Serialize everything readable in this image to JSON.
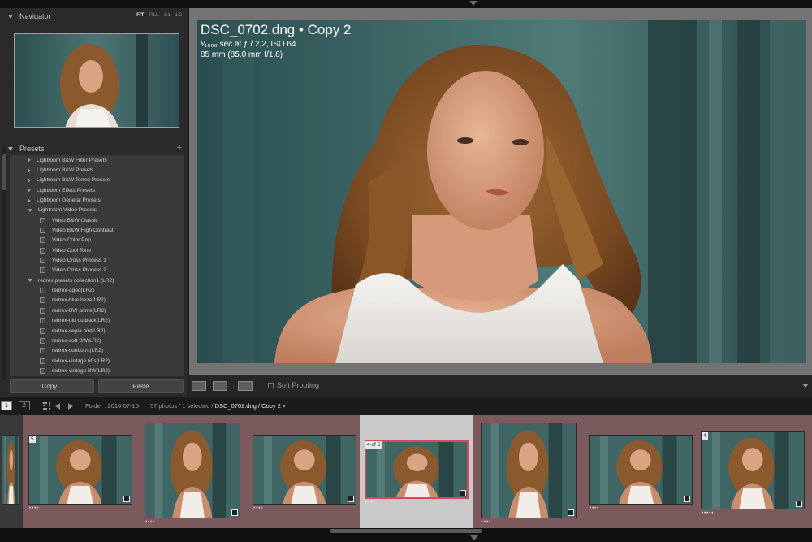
{
  "navigator": {
    "title": "Navigator",
    "modes": [
      "FIT",
      "FILL",
      "1:1",
      "1:2"
    ]
  },
  "presets": {
    "title": "Presets",
    "add_icon": "plus-icon",
    "rows": [
      {
        "kind": "folder",
        "open": false,
        "label": "Lightroom B&W Filter Presets"
      },
      {
        "kind": "folder",
        "open": false,
        "label": "Lightroom B&W Presets"
      },
      {
        "kind": "folder",
        "open": false,
        "label": "Lightroom B&W Toned Presets"
      },
      {
        "kind": "folder",
        "open": false,
        "label": "Lightroom Effect Presets"
      },
      {
        "kind": "folder",
        "open": false,
        "label": "Lightroom General Presets"
      },
      {
        "kind": "folder",
        "open": true,
        "label": "Lightroom Video Presets"
      },
      {
        "kind": "item",
        "label": "Video B&W Classic"
      },
      {
        "kind": "item",
        "label": "Video B&W High Contrast"
      },
      {
        "kind": "item",
        "label": "Video Color Pop"
      },
      {
        "kind": "item",
        "label": "Video Cool Tone"
      },
      {
        "kind": "item",
        "label": "Video Cross Process 1"
      },
      {
        "kind": "item",
        "label": "Video Cross Process 2"
      },
      {
        "kind": "folder",
        "open": true,
        "label": "redrex presets collection1 (LR2)"
      },
      {
        "kind": "item",
        "label": "redrex-aged(LR2)"
      },
      {
        "kind": "item",
        "label": "redrex-blue haze(LR2)"
      },
      {
        "kind": "item",
        "label": "redrex-BW prime(LR2)"
      },
      {
        "kind": "item",
        "label": "redrex-old outback(LR2)"
      },
      {
        "kind": "item",
        "label": "redrex-sepia hint(LR2)"
      },
      {
        "kind": "item",
        "label": "redrex-soft BW(LR2)"
      },
      {
        "kind": "item",
        "label": "redrex-sunburnt(LR2)"
      },
      {
        "kind": "item",
        "label": "redrex-vintage 60s(LR2)"
      },
      {
        "kind": "item",
        "label": "redrex-vintage BW(LR2)"
      }
    ]
  },
  "buttons": {
    "copy": "Copy...",
    "paste": "Paste"
  },
  "photo_info": {
    "filename": "DSC_0702.dng  •  Copy 2",
    "exposure": "¹⁄₁₀₀₀ sec at ƒ / 2,2, ISO 64",
    "lens": "85 mm (85.0 mm f/1.8)"
  },
  "toolbar": {
    "soft_proofing": "Soft Proofing"
  },
  "filmstrip_bar": {
    "screen1": "1",
    "screen2": "2",
    "folder": "Folder : 2016-07-15",
    "count": "57 photos / 1 selected / ",
    "current": "DSC_0702.dng / Copy 2",
    "dropdown": "▾"
  },
  "filmstrip": {
    "badges": {
      "first": "5",
      "selected": "4 of 5",
      "last": "4"
    },
    "stars": [
      "••••",
      "••••",
      "••••",
      "••••",
      "••••",
      "••••",
      "•••••"
    ]
  },
  "colors": {
    "selection": "#d84a55",
    "stack_cell": "#7a5a5d"
  }
}
